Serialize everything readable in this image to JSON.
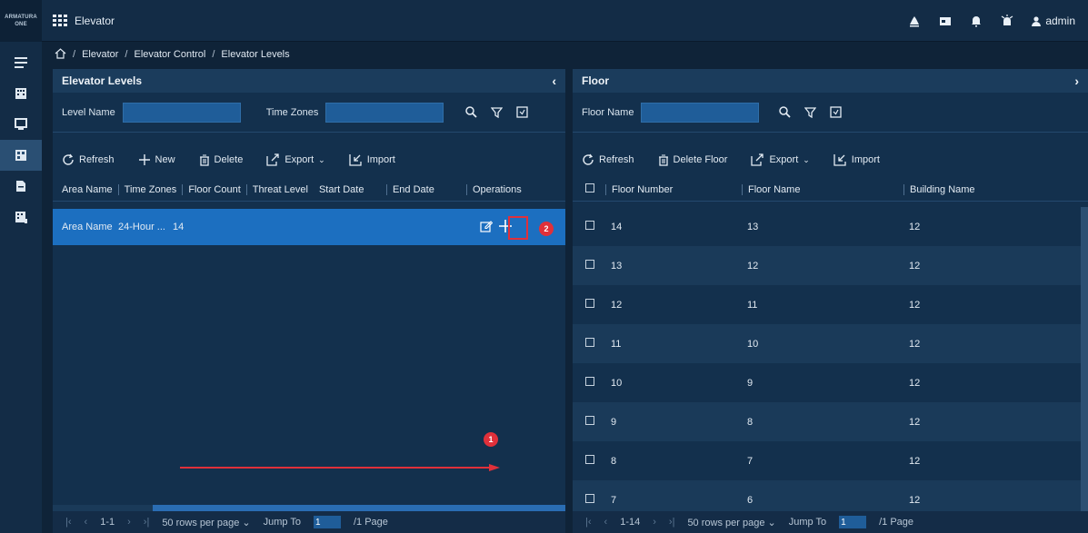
{
  "topbar": {
    "logo_line1": "ARMATURA",
    "logo_line2": "ONE",
    "app_title": "Elevator",
    "user": "admin",
    "icons": [
      "bell-alarm-icon",
      "card-icon",
      "notification-icon",
      "alarm-icon",
      "user-icon"
    ]
  },
  "nav": {
    "items": [
      "menu-icon",
      "building-icon",
      "monitor-icon",
      "elevator-icon",
      "report-icon",
      "floor-icon"
    ],
    "active_index": 3
  },
  "breadcrumb": {
    "home_icon": "home-icon",
    "items": [
      "Elevator",
      "Elevator Control",
      "Elevator Levels"
    ],
    "sep": "/"
  },
  "left": {
    "title": "Elevator Levels",
    "collapse": "‹",
    "search": {
      "level_name_label": "Level Name",
      "time_zones_label": "Time Zones",
      "level_name_value": "",
      "time_zones_value": ""
    },
    "toolbar": {
      "refresh": "Refresh",
      "new": "New",
      "delete": "Delete",
      "export": "Export",
      "import": "Import"
    },
    "columns": [
      "Area Name",
      "Time Zones",
      "Floor Count",
      "Threat Level",
      "Start Date",
      "End Date",
      "Operations"
    ],
    "rows": [
      {
        "area_name": "Area Name",
        "time_zones": "24-Hour ...",
        "floor_count": "14"
      }
    ],
    "markers": {
      "one": "1",
      "two": "2"
    },
    "pager": {
      "range": "1-1",
      "rows_per_page": "50 rows per page",
      "jump_to": "Jump To",
      "page_value": "1",
      "page_total": "/1 Page"
    }
  },
  "right": {
    "title": "Floor",
    "expand": "›",
    "search": {
      "floor_name_label": "Floor Name",
      "floor_name_value": ""
    },
    "toolbar": {
      "refresh": "Refresh",
      "delete_floor": "Delete Floor",
      "export": "Export",
      "import": "Import"
    },
    "columns": [
      "Floor Number",
      "Floor Name",
      "Building Name"
    ],
    "rows": [
      {
        "number": "14",
        "name": "13",
        "building": "12"
      },
      {
        "number": "13",
        "name": "12",
        "building": "12"
      },
      {
        "number": "12",
        "name": "11",
        "building": "12"
      },
      {
        "number": "11",
        "name": "10",
        "building": "12"
      },
      {
        "number": "10",
        "name": "9",
        "building": "12"
      },
      {
        "number": "9",
        "name": "8",
        "building": "12"
      },
      {
        "number": "8",
        "name": "7",
        "building": "12"
      },
      {
        "number": "7",
        "name": "6",
        "building": "12"
      }
    ],
    "pager": {
      "range": "1-14",
      "rows_per_page": "50 rows per page",
      "jump_to": "Jump To",
      "page_value": "1",
      "page_total": "/1 Page"
    }
  },
  "colors": {
    "accent": "#1c6fc0",
    "marker": "#e0303a"
  }
}
